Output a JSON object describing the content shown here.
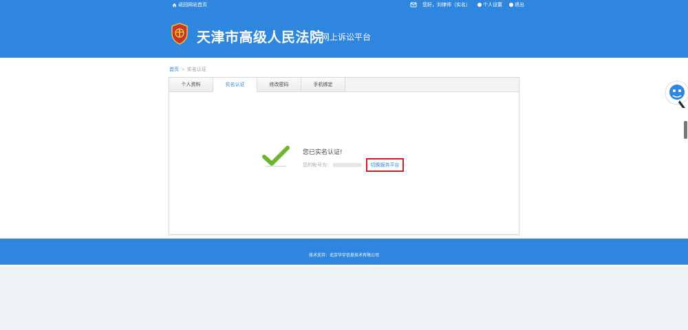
{
  "topbar": {
    "home_link": "返回网站首页",
    "welcome": "您好，刘律师（实名）",
    "settings": "个人设置",
    "logout": "退出"
  },
  "header": {
    "title": "天津市高级人民法院",
    "subtitle": "网上诉讼平台"
  },
  "breadcrumb": {
    "home": "首页",
    "separator": ">",
    "current": "实名认证"
  },
  "tabs": [
    {
      "label": "个人资料",
      "active": false
    },
    {
      "label": "实名认证",
      "active": true
    },
    {
      "label": "修改密码",
      "active": false
    },
    {
      "label": "手机绑定",
      "active": false
    }
  ],
  "status": {
    "title": "您已实名认证!",
    "account_prefix": "您的帐号为："
  },
  "switch_button": "切换服务平台",
  "footer": {
    "support": "技术支持：北京华宇信息技术有限公司"
  },
  "colors": {
    "brand": "#2f86df",
    "check": "#6fb52c",
    "highlight": "#cc1f1f"
  }
}
